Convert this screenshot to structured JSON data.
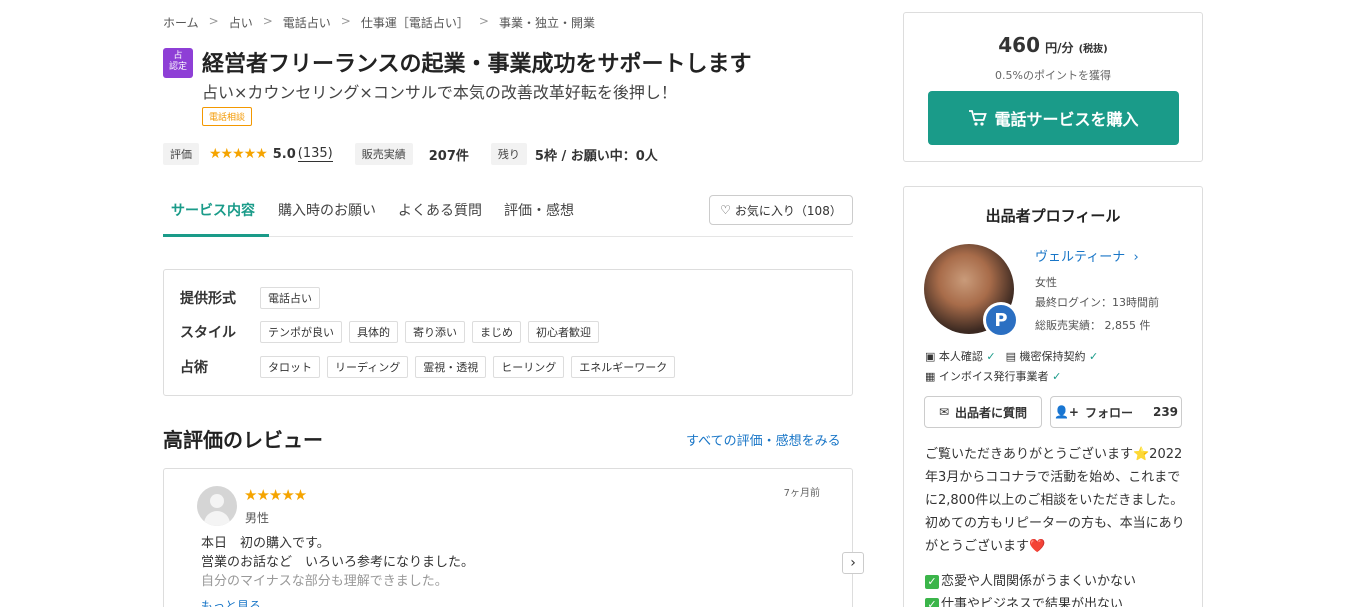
{
  "breadcrumb": [
    "ホーム",
    "占い",
    "電話占い",
    "仕事運［電話占い］",
    "事業・独立・開業"
  ],
  "badge": {
    "line1": "占",
    "line2": "認定"
  },
  "title": "経営者フリーランスの起業・事業成功をサポートします",
  "subtitle": "占い×カウンセリング×コンサルで本気の改善改革好転を後押し！",
  "service_tag": "電話相談",
  "stats": {
    "rating_label": "評価",
    "stars": "★★★★★",
    "rating": "5.0",
    "rating_count": "(135)",
    "sales_label": "販売実績",
    "sales_value": "207件",
    "remaining_label": "残り",
    "remaining_value": "5枠 / お願い中：0人"
  },
  "tabs": [
    {
      "label": "サービス内容",
      "active": true
    },
    {
      "label": "購入時のお願い",
      "active": false
    },
    {
      "label": "よくある質問",
      "active": false
    },
    {
      "label": "評価・感想",
      "active": false
    }
  ],
  "favorite": {
    "label": "お気に入り（108）"
  },
  "specs": [
    {
      "label": "提供形式",
      "chips": [
        "電話占い"
      ]
    },
    {
      "label": "スタイル",
      "chips": [
        "テンポが良い",
        "具体的",
        "寄り添い",
        "まじめ",
        "初心者歓迎"
      ]
    },
    {
      "label": "占術",
      "chips": [
        "タロット",
        "リーディング",
        "霊視・透視",
        "ヒーリング",
        "エネルギーワーク"
      ]
    }
  ],
  "reviews_section": {
    "heading": "高評価のレビュー",
    "all_link": "すべての評価・感想をみる"
  },
  "review": {
    "stars": "★★★★★",
    "gender": "男性",
    "date": "7ヶ月前",
    "lines": [
      "本日　初の購入です。",
      "営業のお話など　いろいろ参考になりました。",
      "自分のマイナスな部分も理解できました。"
    ],
    "more": "もっと見る"
  },
  "price": {
    "amount": "460",
    "unit": "円/分",
    "tax": "(税抜)",
    "points": "0.5%のポイントを獲得",
    "buy_label": "電話サービスを購入"
  },
  "profile": {
    "title": "出品者プロフィール",
    "name": "ヴェルティーナ",
    "gender": "女性",
    "last_login": "最終ログイン：13時間前",
    "total_sales": "総販売実績： 2,855 件",
    "badge_letter": "P",
    "verifications": [
      "本人確認",
      "機密保持契約",
      "インボイス発行事業者"
    ],
    "ask_label": "出品者に質問",
    "follow_label": "フォロー",
    "follow_count": "239",
    "intro": "ご覧いただきありがとうございます⭐2022年3月からココナラで活動を始め、これまでに2,800件以上のご相談をいただきました。初めての方もリピーターの方も、本当にありがとうございます❤️",
    "intro_item1": "恋愛や人間関係がうまくいかない",
    "intro_item2": "仕事やビジネスで結果が出ない"
  },
  "colors": {
    "accent": "#1a9b89",
    "link": "#1976c7",
    "star": "#f5a400",
    "badge_purple": "#8e3fd6",
    "tag_orange": "#f39800"
  }
}
